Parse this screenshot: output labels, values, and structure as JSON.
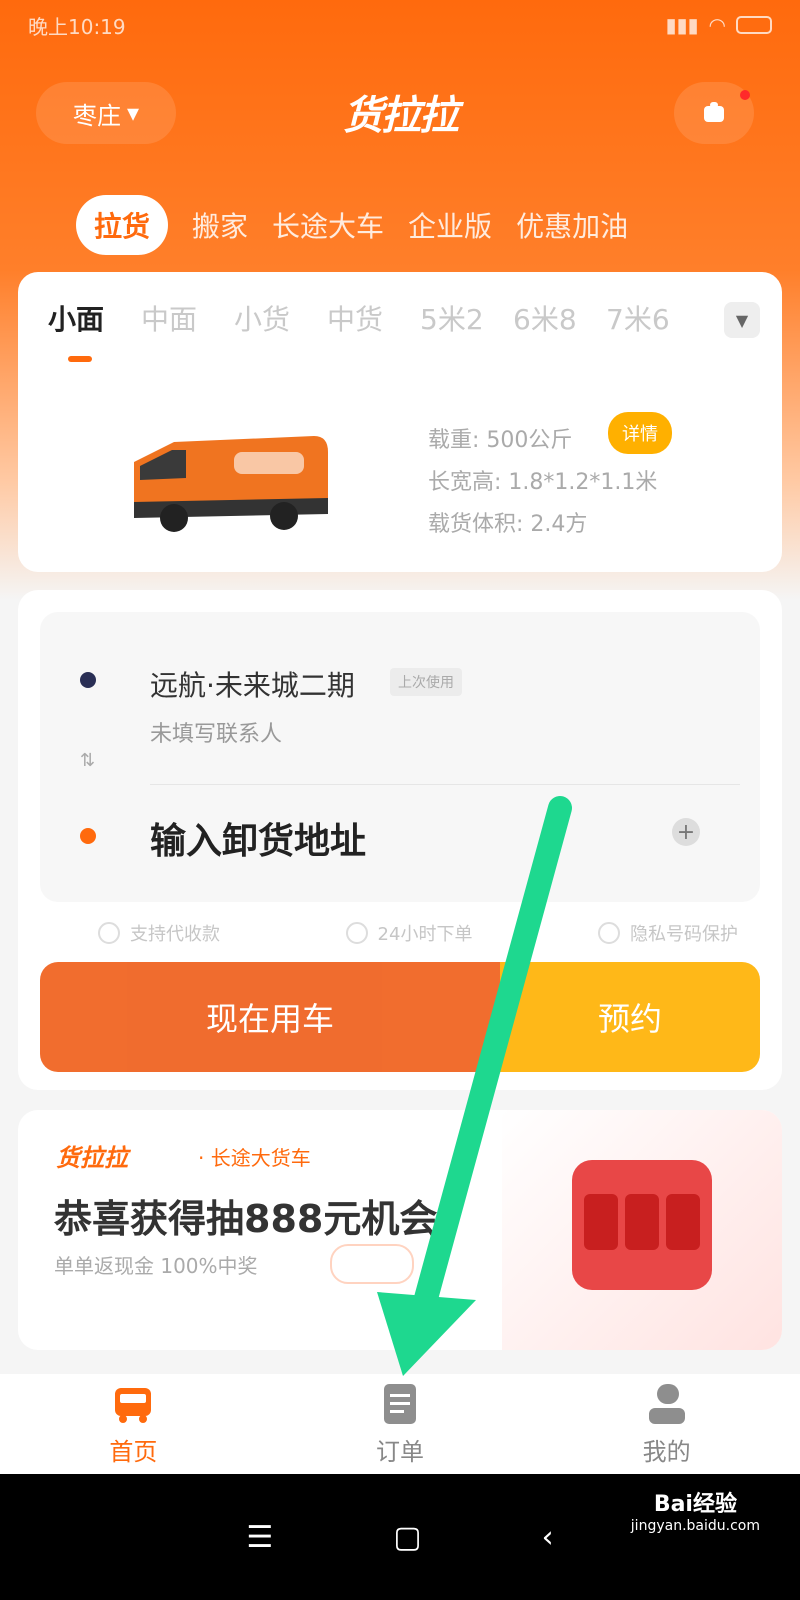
{
  "status_bar": {
    "time": "晚上10:19"
  },
  "header": {
    "city": "枣庄",
    "logo_text": "货拉拉"
  },
  "service_tabs": [
    "拉货",
    "搬家",
    "长途大车",
    "企业版",
    "优惠加油"
  ],
  "vehicle": {
    "types": [
      "小面",
      "中面",
      "小货",
      "中货",
      "5米2",
      "6米8",
      "7米6"
    ],
    "specs": [
      "载重: 500公斤",
      "长宽高: 1.8*1.2*1.1米",
      "载货体积: 2.4方"
    ],
    "badge": "详情"
  },
  "address": {
    "pickup_title": "远航·未来城二期",
    "pickup_tag": "上次使用",
    "pickup_contact": "未填写联系人",
    "dropoff_placeholder": "输入卸货地址",
    "options": [
      "支持代收款",
      "24小时下单",
      "隐私号码保护"
    ],
    "now_button": "现在用车",
    "book_button": "预约"
  },
  "promo": {
    "brand": "货拉拉",
    "subtitle": "· 长途大货车",
    "title": "恭喜获得抽888元机会",
    "desc": "单单返现金 100%中奖"
  },
  "bottom_nav": {
    "home": "首页",
    "orders": "订单",
    "mine": "我的"
  },
  "watermark": {
    "brand": "Bai经验",
    "url": "jingyan.baidu.com"
  },
  "colors": {
    "brand_orange": "#ff6a0d",
    "book_yellow": "#ffb818",
    "arrow_green": "#1ed88f"
  }
}
